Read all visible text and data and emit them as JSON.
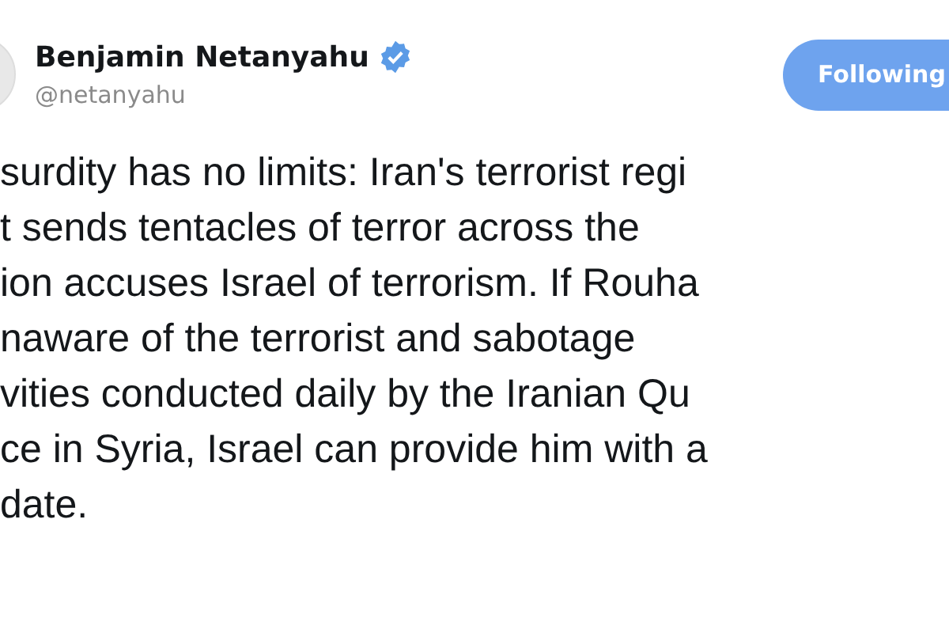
{
  "author": {
    "name": "Benjamin Netanyahu",
    "verified": true,
    "handle": "@netanyahu"
  },
  "follow_button": {
    "label": "Following"
  },
  "tweet_lines": [
    "surdity has no limits: Iran's terrorist regi",
    "t sends tentacles of terror across the",
    "ion accuses Israel of terrorism. If Rouha",
    "naware of the terrorist and sabotage",
    "vities conducted daily by the Iranian Qu",
    "ce in Syria, Israel can provide him with a",
    "date."
  ]
}
